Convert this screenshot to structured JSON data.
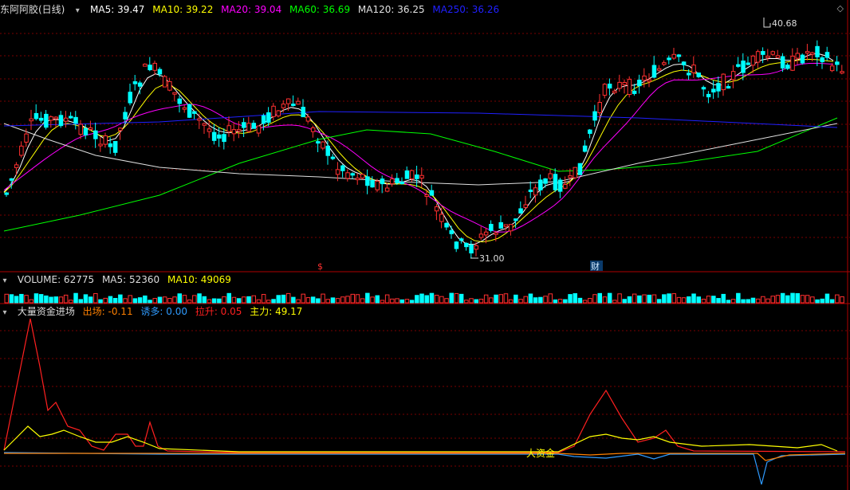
{
  "main": {
    "title": "东阿阿胶(日线)",
    "ma": [
      {
        "label": "MA5: 39.47",
        "color": "#ffffff"
      },
      {
        "label": "MA10: 39.22",
        "color": "#ffff00"
      },
      {
        "label": "MA20: 39.04",
        "color": "#ff00ff"
      },
      {
        "label": "MA60: 36.69",
        "color": "#00ff00"
      },
      {
        "label": "MA120: 36.25",
        "color": "#e0e0e0"
      },
      {
        "label": "MA250: 36.26",
        "color": "#2020ff"
      }
    ],
    "high_label": "40.68",
    "low_label": "31.00",
    "marker_s": "$",
    "marker_cai": "财"
  },
  "volume": {
    "label": "VOLUME: 62775",
    "ma5": "MA5: 52360",
    "ma10": "MA10: 49069"
  },
  "indicator": {
    "name": "大量资金进场",
    "items": [
      {
        "label": "出场: -0.11",
        "color": "#ff8000"
      },
      {
        "label": "诱多: 0.00",
        "color": "#2f9bff"
      },
      {
        "label": "拉升: 0.05",
        "color": "#ff2020"
      },
      {
        "label": "主力: 49.17",
        "color": "#ffff00"
      }
    ],
    "annotation": "大资金"
  },
  "colors": {
    "up": "#ff3030",
    "down": "#00ffff",
    "bg": "#000000"
  }
}
